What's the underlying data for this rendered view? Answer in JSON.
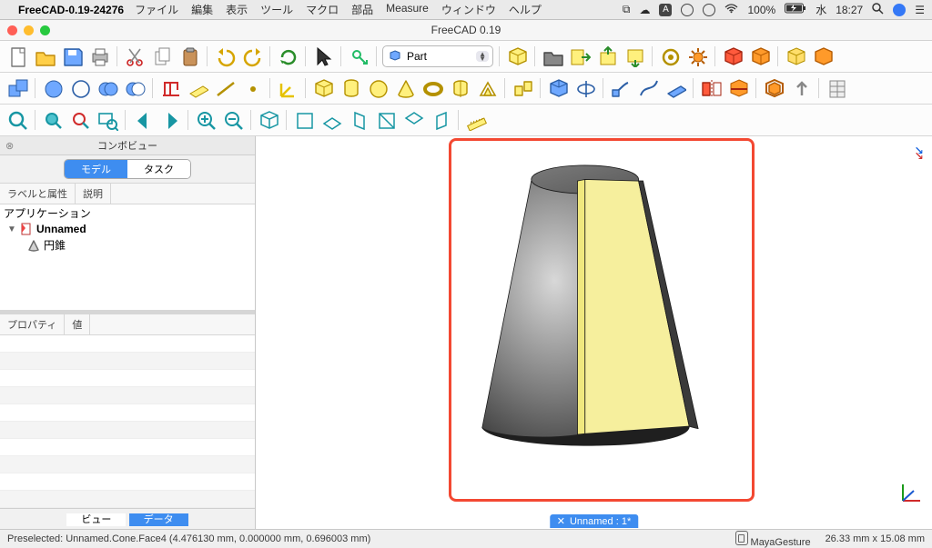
{
  "macbar": {
    "app_name": "FreeCAD-0.19-24276",
    "menus": [
      "ファイル",
      "編集",
      "表示",
      "ツール",
      "マクロ",
      "部品",
      "Measure",
      "ウィンドウ",
      "ヘルプ"
    ],
    "battery": "100%",
    "day": "水",
    "time": "18:27"
  },
  "window": {
    "title": "FreeCAD 0.19"
  },
  "workbench_selector": {
    "label": "Part"
  },
  "combo": {
    "panel_title": "コンボビュー",
    "tab_model": "モデル",
    "tab_task": "タスク",
    "col_label": "ラベルと属性",
    "col_desc": "説明",
    "tree_app": "アプリケーション",
    "tree_doc": "Unnamed",
    "tree_obj": "円錐",
    "prop_col_name": "プロパティ",
    "prop_col_val": "値",
    "tab_view": "ビュー",
    "tab_data": "データ"
  },
  "mdi_tab": "Unnamed : 1*",
  "status": {
    "preselect": "Preselected: Unnamed.Cone.Face4 (4.476130 mm, 0.000000 mm, 0.696003 mm)",
    "nav_style": "MayaGesture",
    "dims": "26.33 mm x 15.08 mm"
  },
  "icons": {
    "toolbar1": [
      "new-doc",
      "open",
      "save",
      "print",
      "sep",
      "cut",
      "copy",
      "paste",
      "sep",
      "undo",
      "redo",
      "sep",
      "refresh",
      "sep",
      "arrow-cursor",
      "sep",
      "link-go",
      "sep",
      "workbench-select",
      "sep",
      "part-cube",
      "sep",
      "open-folder",
      "export-right",
      "export-up",
      "export-down",
      "sep",
      "loop-select",
      "gear-orange",
      "sep",
      "red-cube",
      "orange-cube",
      "sep",
      "isometric-cube",
      "orange-cube2"
    ],
    "toolbar2": [
      "bool-common",
      "sep",
      "sphere-blue",
      "sphere-outline",
      "sphere-union",
      "sphere-cut",
      "sep",
      "attach-red",
      "datum-plane",
      "datum-line",
      "datum-point",
      "sep",
      "lcs",
      "sep",
      "box-yel",
      "cylinder-yel",
      "sphere-yel",
      "cone-yel",
      "torus-yel",
      "prism-yel",
      "wedge-yel",
      "sep",
      "compound",
      "sep",
      "extrude",
      "revolve",
      "sep",
      "sweep-face",
      "sweep-path",
      "sweep-blue",
      "sep",
      "mirror-red",
      "cut-red",
      "sep",
      "thickness-org",
      "export-up2",
      "sep",
      "sheet"
    ],
    "toolbar3": [
      "magnifier",
      "sep",
      "zoom-all",
      "zoom-sel",
      "zoom-window",
      "sep",
      "nav-back",
      "nav-fwd",
      "sep",
      "zoom-in",
      "zoom-out",
      "sep",
      "iso-box",
      "sep",
      "ortho-front",
      "ortho-top",
      "ortho-right",
      "ortho-back",
      "ortho-bottom",
      "ortho-left",
      "sep",
      "measure-ruler"
    ]
  }
}
